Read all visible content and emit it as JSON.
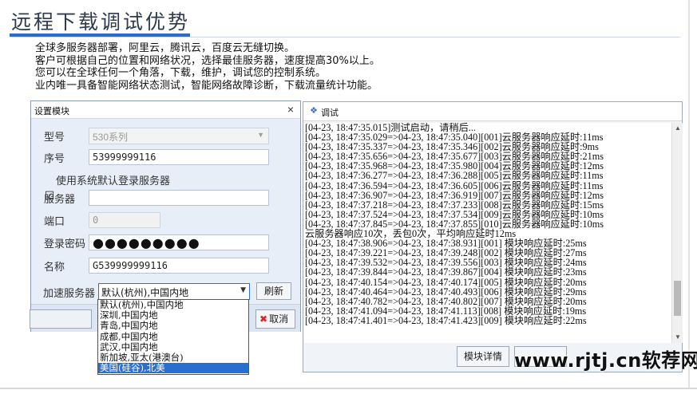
{
  "heading": "远程下载调试优势",
  "intro": [
    "全球多服务器部署，阿里云，腾讯云，百度云无缝切换。",
    "客户可根据自己的位置和网络状况，选择最佳服务器，速度提高30%以上。",
    "您可以在全球任何一个角落，下载，维护，调试您的控制系统。",
    "业内唯一具备智能网络状态测试，智能网络故障诊断，下载流量统计功能。"
  ],
  "settings_dialog": {
    "title": "设置模块",
    "close": "×",
    "model_label": "型号",
    "model_value": "530系列",
    "serial_label": "序号",
    "serial_value": "53999999116",
    "use_default_server_label": "使用系统默认登录服务器",
    "use_default_checked_mark": "☑",
    "server_label": "服务器",
    "server_value": "",
    "port_label": "端口",
    "port_value": "0",
    "password_label": "登录密码",
    "password_value": "●●●●●●●●●",
    "name_label": "名称",
    "name_value": "G539999999116",
    "accel_label": "加速服务器",
    "accel_value": "默认(杭州),中国内地",
    "refresh_label": "刷新",
    "cancel_label": "取消",
    "cancel_icon": "✖"
  },
  "accel_options": [
    "默认(杭州),中国内地",
    "深圳,中国内地",
    "青岛,中国内地",
    "成都,中国内地",
    "武汉,中国内地",
    "新加坡,亚太(港澳台)",
    "美国(硅谷),北美"
  ],
  "debug_window": {
    "title": "调试",
    "detail_button": "模块详情",
    "log": [
      "[04-23, 18:47:35.015]测试启动，请稍后...",
      "[04-23, 18:47:35.029=>04-23, 18:47:35.040][001]云服务器响应延时:11ms",
      "[04-23, 18:47:35.337=>04-23, 18:47:35.346][002]云服务器响应延时:9ms",
      "[04-23, 18:47:35.656=>04-23, 18:47:35.677][003]云服务器响应延时:21ms",
      "[04-23, 18:47:35.968=>04-23, 18:47:35.980][004]云服务器响应延时:12ms",
      "[04-23, 18:47:36.277=>04-23, 18:47:36.288][005]云服务器响应延时:11ms",
      "[04-23, 18:47:36.594=>04-23, 18:47:36.605][006]云服务器响应延时:11ms",
      "[04-23, 18:47:36.907=>04-23, 18:47:36.919][007]云服务器响应延时:12ms",
      "[04-23, 18:47:37.218=>04-23, 18:47:37.233][008]云服务器响应延时:15ms",
      "[04-23, 18:47:37.524=>04-23, 18:47:37.534][009]云服务器响应延时:10ms",
      "[04-23, 18:47:37.845=>04-23, 18:47:37.855][010]云服务器响应延时:10ms",
      "云服务器响应10次，丢包0次，平均响应延时12ms",
      "[04-23, 18:47:38.906=>04-23, 18:47:38.931][001] 模块响应延时:25ms",
      "[04-23, 18:47:39.221=>04-23, 18:47:39.248][002] 模块响应延时:27ms",
      "[04-23, 18:47:39.532=>04-23, 18:47:39.556][003] 模块响应延时:24ms",
      "[04-23, 18:47:39.844=>04-23, 18:47:39.867][004] 模块响应延时:23ms",
      "[04-23, 18:47:40.154=>04-23, 18:47:40.174][005] 模块响应延时:20ms",
      "[04-23, 18:47:40.464=>04-23, 18:47:40.493][006] 模块响应延时:29ms",
      "[04-23, 18:47:40.782=>04-23, 18:47:40.802][007] 模块响应延时:20ms",
      "[04-23, 18:47:41.094=>04-23, 18:47:41.113][008] 模块响应延时:19ms",
      "[04-23, 18:47:41.401=>04-23, 18:47:41.423][009] 模块响应延时:22ms"
    ]
  },
  "watermark": "www.rjtj.cn软荐网",
  "colors": {
    "accent": "#2e6bd1",
    "selected": "#2a6fd0",
    "cancel_icon": "#dd2222"
  }
}
